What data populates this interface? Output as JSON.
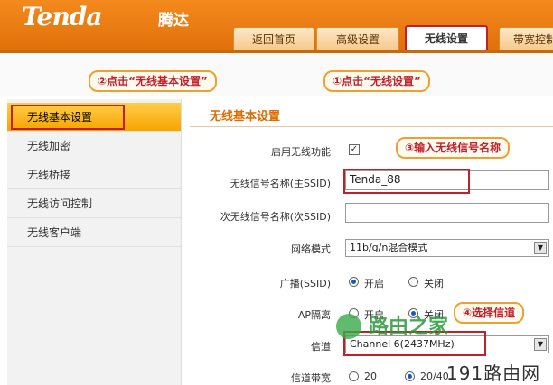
{
  "brand": {
    "logo": "Tenda",
    "logo_cn": "腾达"
  },
  "tabs": [
    {
      "label": "返回首页"
    },
    {
      "label": "高级设置"
    },
    {
      "label": "无线设置"
    },
    {
      "label": "带宽控制"
    }
  ],
  "callouts": {
    "step1": "①点击“无线设置”",
    "step2": "②点击“无线基本设置”",
    "step3": "③输入无线信号名称",
    "step4": "④选择信道"
  },
  "sidebar": {
    "items": [
      {
        "label": "无线基本设置"
      },
      {
        "label": "无线加密"
      },
      {
        "label": "无线桥接"
      },
      {
        "label": "无线访问控制"
      },
      {
        "label": "无线客户端"
      }
    ]
  },
  "main": {
    "title": "无线基本设置",
    "enable_label": "启用无线功能",
    "enable_checked": "✓",
    "ssid_label": "无线信号名称(主SSID)",
    "ssid_value": "Tenda_88",
    "ssid2_label": "次无线信号名称(次SSID)",
    "ssid2_value": "",
    "mode_label": "网络模式",
    "mode_value": "11b/g/n混合模式",
    "broadcast_label": "广播(SSID)",
    "broadcast_on": "开启",
    "broadcast_off": "关闭",
    "ap_label": "AP隔离",
    "ap_on": "开启",
    "ap_off": "关闭",
    "channel_label": "信道",
    "channel_value": "Channel 6(2437MHz)",
    "bandwidth_label": "信道带宽",
    "bw_20": "20",
    "bw_40": "20/40"
  },
  "watermarks": {
    "brand_cn": "路由之家",
    "site": "191路由网"
  }
}
